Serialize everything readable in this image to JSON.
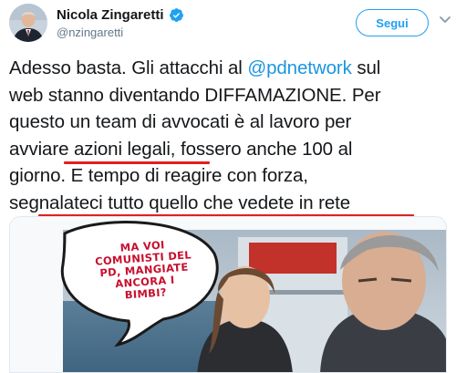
{
  "author": {
    "display_name": "Nicola Zingaretti",
    "handle": "@nzingaretti",
    "verified": true,
    "avatar_icon": "person-portrait-icon"
  },
  "actions": {
    "follow_label": "Segui",
    "more_icon": "chevron-down-icon"
  },
  "tweet": {
    "lines": [
      [
        "Adesso basta. Gli attacchi al ",
        "@pdnetwork",
        " sul"
      ],
      [
        "web stanno diventando DIFFAMAZIONE. Per",
        "",
        ""
      ],
      [
        "questo un team di avvocati è al lavoro per",
        "",
        ""
      ],
      [
        "avviare azioni legali, fossero anche 100 al",
        "",
        ""
      ],
      [
        "giorno. E tempo di reagire con forza,",
        "",
        ""
      ],
      [
        "segnalateci tutto quello che vedete in rete",
        "",
        ""
      ]
    ],
    "mention_color": "#1b95e0",
    "underline_color": "#e02020"
  },
  "media": {
    "speech_bubble_text": [
      "MA VOI",
      "COMUNISTI DEL",
      "PD, MANGIATE",
      "ANCORA I",
      "BIMBI?"
    ],
    "bubble_text_color": "#c8102e"
  },
  "colors": {
    "accent": "#1da1f2",
    "secondary_text": "#657786",
    "primary_text": "#14171a"
  }
}
